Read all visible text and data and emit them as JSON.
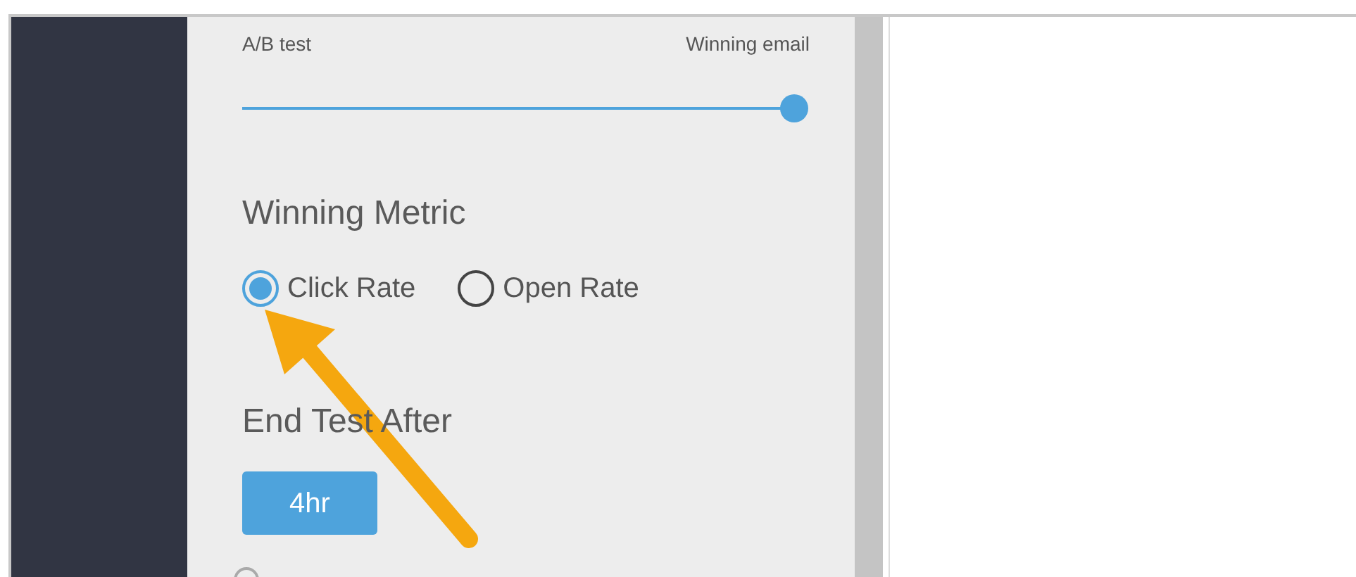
{
  "slider": {
    "left_label": "A/B test",
    "right_label": "Winning email",
    "level": 1
  },
  "winning_metric": {
    "heading": "Winning Metric",
    "options": [
      {
        "label": "Click Rate",
        "selected": true
      },
      {
        "label": "Open Rate",
        "selected": false
      }
    ]
  },
  "end_test": {
    "heading": "End Test After",
    "button": "4hr"
  }
}
